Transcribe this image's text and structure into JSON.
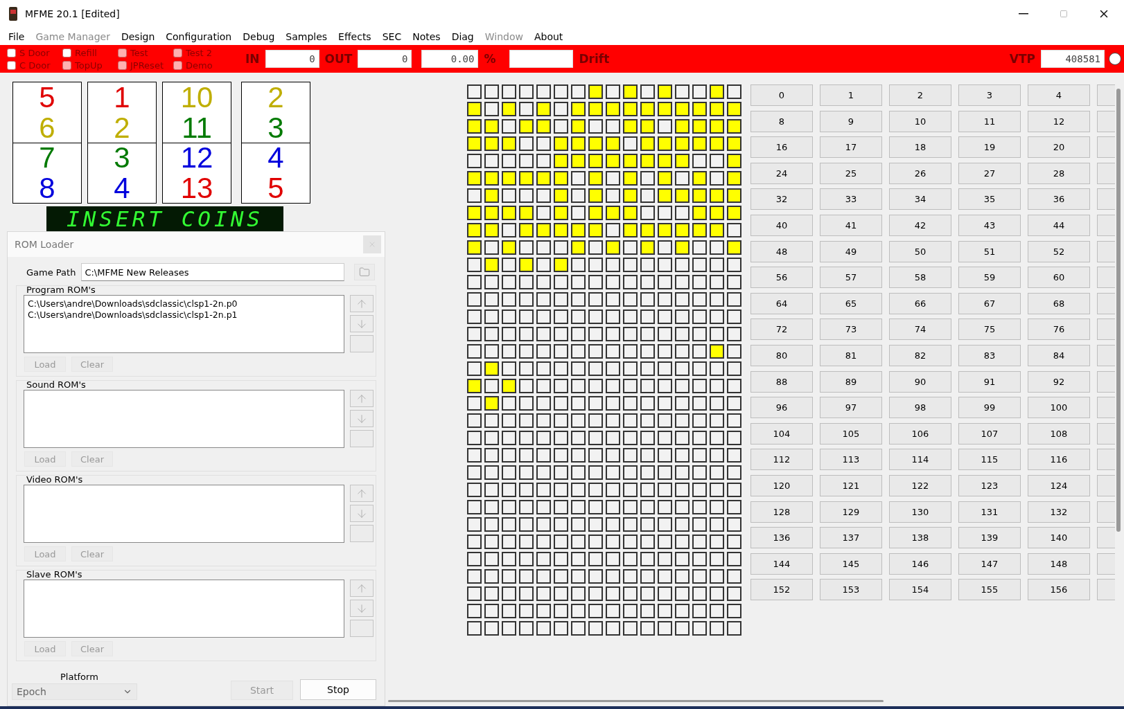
{
  "window": {
    "title": "MFME 20.1 [Edited]"
  },
  "menu": [
    {
      "label": "File",
      "disabled": false
    },
    {
      "label": "Game Manager",
      "disabled": true
    },
    {
      "label": "Design",
      "disabled": false
    },
    {
      "label": "Configuration",
      "disabled": false
    },
    {
      "label": "Debug",
      "disabled": false
    },
    {
      "label": "Samples",
      "disabled": false
    },
    {
      "label": "Effects",
      "disabled": false
    },
    {
      "label": "SEC",
      "disabled": false
    },
    {
      "label": "Notes",
      "disabled": false
    },
    {
      "label": "Diag",
      "disabled": false
    },
    {
      "label": "Window",
      "disabled": true
    },
    {
      "label": "About",
      "disabled": false
    }
  ],
  "toolbar": {
    "switches": [
      {
        "label": "S Door",
        "checked": false,
        "disabled": false
      },
      {
        "label": "C Door",
        "checked": false,
        "disabled": false
      },
      {
        "label": "Refill",
        "checked": false,
        "disabled": false
      },
      {
        "label": "TopUp",
        "checked": false,
        "disabled": true
      },
      {
        "label": "Test",
        "checked": false,
        "disabled": true
      },
      {
        "label": "JPReset",
        "checked": false,
        "disabled": true
      },
      {
        "label": "Test 2",
        "checked": false,
        "disabled": true
      },
      {
        "label": "Demo",
        "checked": false,
        "disabled": true
      }
    ],
    "in_label": "IN",
    "in_value": "0",
    "out_label": "OUT",
    "out_value": "0",
    "percent_value": "0.00",
    "percent_label": "%",
    "drift_label": "Drift",
    "vtp_label": "VTP",
    "vtp_value": "408581"
  },
  "reels": [
    {
      "symbols": [
        {
          "text": "5",
          "color": "#e00000"
        },
        {
          "text": "6",
          "color": "#bfae00"
        },
        {
          "text": "7",
          "color": "#007a00"
        },
        {
          "text": "8",
          "color": "#0000dd"
        }
      ]
    },
    {
      "symbols": [
        {
          "text": "1",
          "color": "#e00000"
        },
        {
          "text": "2",
          "color": "#bfae00"
        },
        {
          "text": "3",
          "color": "#007a00"
        },
        {
          "text": "4",
          "color": "#0000dd"
        }
      ]
    },
    {
      "symbols": [
        {
          "text": "10",
          "color": "#bfae00"
        },
        {
          "text": "11",
          "color": "#007a00"
        },
        {
          "text": "12",
          "color": "#0000dd"
        },
        {
          "text": "13",
          "color": "#e00000"
        }
      ]
    },
    {
      "symbols": [
        {
          "text": "2",
          "color": "#bfae00"
        },
        {
          "text": "3",
          "color": "#007a00"
        },
        {
          "text": "4",
          "color": "#0000dd"
        },
        {
          "text": "5",
          "color": "#e00000"
        }
      ]
    }
  ],
  "display": {
    "text": "INSERT COINS"
  },
  "rom_loader": {
    "title": "ROM Loader",
    "game_path_label": "Game Path",
    "game_path": "C:\\MFME New Releases",
    "sections": [
      {
        "title": "Program ROM's",
        "files": [
          "C:\\Users\\andre\\Downloads\\sdclassic\\clsp1-2n.p0",
          "C:\\Users\\andre\\Downloads\\sdclassic\\clsp1-2n.p1"
        ],
        "load": "Load",
        "clear": "Clear"
      },
      {
        "title": "Sound ROM's",
        "load": "Load",
        "clear": "Clear"
      },
      {
        "title": "Video ROM's",
        "load": "Load",
        "clear": "Clear"
      },
      {
        "title": "Slave ROM's",
        "load": "Load",
        "clear": "Clear"
      }
    ],
    "platform_label": "Platform",
    "platform": "Epoch",
    "start": "Start",
    "stop": "Stop"
  },
  "lamps": [
    [
      false,
      false,
      false,
      false,
      false,
      false,
      false,
      true,
      false,
      true,
      false,
      true,
      false,
      false,
      true,
      false
    ],
    [
      true,
      false,
      true,
      false,
      true,
      false,
      true,
      true,
      true,
      true,
      true,
      true,
      true,
      true,
      true,
      true
    ],
    [
      true,
      true,
      false,
      true,
      true,
      false,
      true,
      false,
      false,
      true,
      true,
      false,
      true,
      true,
      true,
      true
    ],
    [
      true,
      true,
      true,
      false,
      false,
      true,
      true,
      true,
      true,
      false,
      true,
      true,
      true,
      true,
      true,
      true
    ],
    [
      false,
      false,
      false,
      false,
      false,
      true,
      true,
      true,
      true,
      true,
      true,
      true,
      true,
      false,
      false,
      true
    ],
    [
      true,
      true,
      true,
      true,
      true,
      true,
      false,
      true,
      false,
      true,
      false,
      true,
      false,
      true,
      false,
      true
    ],
    [
      false,
      true,
      false,
      false,
      false,
      true,
      false,
      true,
      false,
      true,
      false,
      true,
      true,
      true,
      true,
      true
    ],
    [
      true,
      true,
      true,
      true,
      false,
      true,
      false,
      true,
      true,
      true,
      false,
      false,
      false,
      true,
      true,
      true
    ],
    [
      true,
      true,
      false,
      true,
      true,
      true,
      true,
      true,
      false,
      true,
      true,
      true,
      true,
      true,
      true,
      false
    ],
    [
      true,
      false,
      true,
      false,
      false,
      false,
      true,
      false,
      true,
      false,
      true,
      false,
      true,
      false,
      false,
      true
    ],
    [
      false,
      true,
      false,
      true,
      false,
      true,
      false,
      false,
      false,
      false,
      false,
      false,
      false,
      false,
      false,
      false
    ],
    [
      false,
      false,
      false,
      false,
      false,
      false,
      false,
      false,
      false,
      false,
      false,
      false,
      false,
      false,
      false,
      false
    ],
    [
      false,
      false,
      false,
      false,
      false,
      false,
      false,
      false,
      false,
      false,
      false,
      false,
      false,
      false,
      false,
      false
    ],
    [
      false,
      false,
      false,
      false,
      false,
      false,
      false,
      false,
      false,
      false,
      false,
      false,
      false,
      false,
      false,
      false
    ],
    [
      false,
      false,
      false,
      false,
      false,
      false,
      false,
      false,
      false,
      false,
      false,
      false,
      false,
      false,
      false,
      false
    ],
    [
      false,
      false,
      false,
      false,
      false,
      false,
      false,
      false,
      false,
      false,
      false,
      false,
      false,
      false,
      true,
      false
    ],
    [
      false,
      true,
      false,
      false,
      false,
      false,
      false,
      false,
      false,
      false,
      false,
      false,
      false,
      false,
      false,
      false
    ],
    [
      true,
      false,
      true,
      false,
      false,
      false,
      false,
      false,
      false,
      false,
      false,
      false,
      false,
      false,
      false,
      false
    ],
    [
      false,
      true,
      false,
      false,
      false,
      false,
      false,
      false,
      false,
      false,
      false,
      false,
      false,
      false,
      false,
      false
    ],
    [
      false,
      false,
      false,
      false,
      false,
      false,
      false,
      false,
      false,
      false,
      false,
      false,
      false,
      false,
      false,
      false
    ],
    [
      false,
      false,
      false,
      false,
      false,
      false,
      false,
      false,
      false,
      false,
      false,
      false,
      false,
      false,
      false,
      false
    ],
    [
      false,
      false,
      false,
      false,
      false,
      false,
      false,
      false,
      false,
      false,
      false,
      false,
      false,
      false,
      false,
      false
    ],
    [
      false,
      false,
      false,
      false,
      false,
      false,
      false,
      false,
      false,
      false,
      false,
      false,
      false,
      false,
      false,
      false
    ],
    [
      false,
      false,
      false,
      false,
      false,
      false,
      false,
      false,
      false,
      false,
      false,
      false,
      false,
      false,
      false,
      false
    ],
    [
      false,
      false,
      false,
      false,
      false,
      false,
      false,
      false,
      false,
      false,
      false,
      false,
      false,
      false,
      false,
      false
    ],
    [
      false,
      false,
      false,
      false,
      false,
      false,
      false,
      false,
      false,
      false,
      false,
      false,
      false,
      false,
      false,
      false
    ],
    [
      false,
      false,
      false,
      false,
      false,
      false,
      false,
      false,
      false,
      false,
      false,
      false,
      false,
      false,
      false,
      false
    ],
    [
      false,
      false,
      false,
      false,
      false,
      false,
      false,
      false,
      false,
      false,
      false,
      false,
      false,
      false,
      false,
      false
    ],
    [
      false,
      false,
      false,
      false,
      false,
      false,
      false,
      false,
      false,
      false,
      false,
      false,
      false,
      false,
      false,
      false
    ],
    [
      false,
      false,
      false,
      false,
      false,
      false,
      false,
      false,
      false,
      false,
      false,
      false,
      false,
      false,
      false,
      false
    ],
    [
      false,
      false,
      false,
      false,
      false,
      false,
      false,
      false,
      false,
      false,
      false,
      false,
      false,
      false,
      false,
      false
    ],
    [
      false,
      false,
      false,
      false,
      false,
      false,
      false,
      false,
      false,
      false,
      false,
      false,
      false,
      false,
      false,
      false
    ]
  ],
  "buttons": [
    "0",
    "1",
    "2",
    "3",
    "4",
    "8",
    "9",
    "10",
    "11",
    "12",
    "16",
    "17",
    "18",
    "19",
    "20",
    "24",
    "25",
    "26",
    "27",
    "28",
    "32",
    "33",
    "34",
    "35",
    "36",
    "40",
    "41",
    "42",
    "43",
    "44",
    "48",
    "49",
    "50",
    "51",
    "52",
    "56",
    "57",
    "58",
    "59",
    "60",
    "64",
    "65",
    "66",
    "67",
    "68",
    "72",
    "73",
    "74",
    "75",
    "76",
    "80",
    "81",
    "82",
    "83",
    "84",
    "88",
    "89",
    "90",
    "91",
    "92",
    "96",
    "97",
    "98",
    "99",
    "100",
    "104",
    "105",
    "106",
    "107",
    "108",
    "112",
    "113",
    "114",
    "115",
    "116",
    "120",
    "121",
    "122",
    "123",
    "124",
    "128",
    "129",
    "130",
    "131",
    "132",
    "136",
    "137",
    "138",
    "139",
    "140",
    "144",
    "145",
    "146",
    "147",
    "148",
    "152",
    "153",
    "154",
    "155",
    "156"
  ]
}
